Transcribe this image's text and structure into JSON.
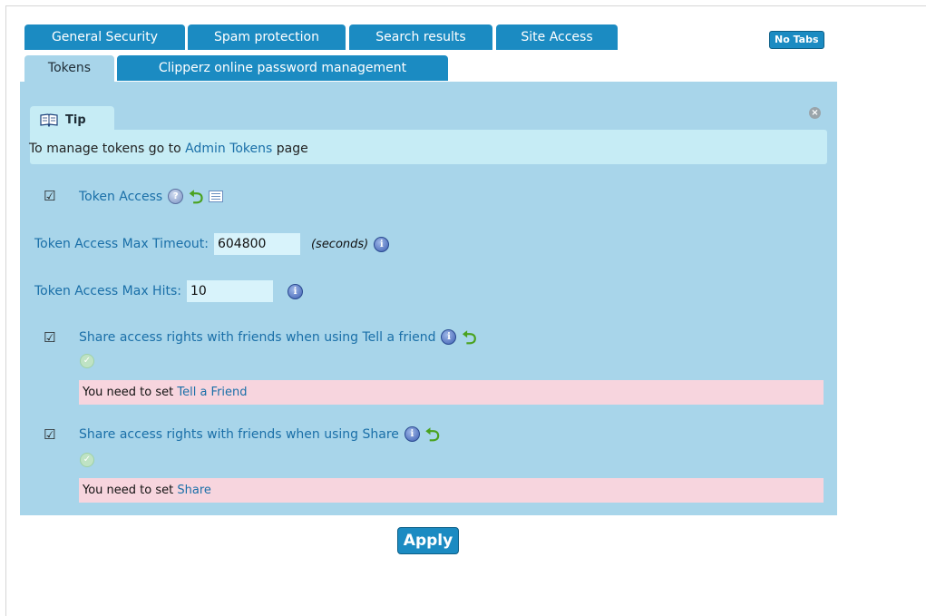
{
  "tabs": [
    {
      "label": "General Security"
    },
    {
      "label": "Spam protection"
    },
    {
      "label": "Search results"
    },
    {
      "label": "Site Access"
    },
    {
      "label": "Tokens",
      "active": true
    },
    {
      "label": "Clipperz online password management"
    }
  ],
  "no_tabs_label": "No Tabs",
  "tip": {
    "title": "Tip",
    "text_before": "To manage tokens go to",
    "link": "Admin Tokens",
    "text_after": "page"
  },
  "token_access": {
    "label": "Token Access",
    "checked": true
  },
  "max_timeout": {
    "label": "Token Access Max Timeout:",
    "value": "604800",
    "unit": "(seconds)"
  },
  "max_hits": {
    "label": "Token Access Max Hits:",
    "value": "10"
  },
  "share_tell_friend": {
    "label": "Share access rights with friends when using Tell a friend",
    "checked": true,
    "warning_prefix": "You need to set",
    "warning_link": "Tell a Friend"
  },
  "share_share": {
    "label": "Share access rights with friends when using Share",
    "checked": true,
    "warning_prefix": "You need to set",
    "warning_link": "Share"
  },
  "apply_label": "Apply",
  "colors": {
    "tab_blue": "#1b8bc2",
    "panel": "#a8d5ea",
    "tip_bg": "#c6ecf5",
    "warning_bg": "#f7d5de",
    "link": "#1a6fa8"
  },
  "icons": [
    "book-icon",
    "close-icon",
    "help-icon",
    "reset-icon",
    "list-icon",
    "info-icon",
    "ok-icon"
  ]
}
